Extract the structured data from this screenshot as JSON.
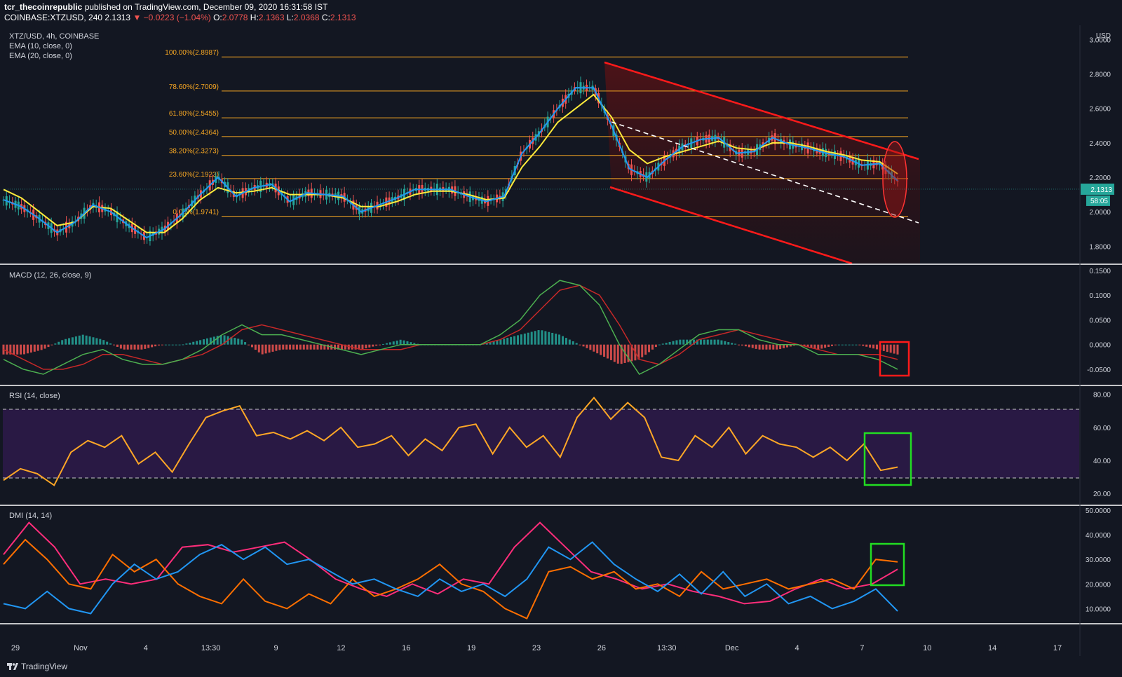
{
  "header": {
    "author": "tcr_thecoinrepublic",
    "published": " published on TradingView.com, December 09, 2020 16:31:58 IST",
    "symbol": "COINBASE:XTZUSD, 240",
    "last": "2.1313",
    "change": "−0.0223 (−1.04%)",
    "o": "2.0778",
    "h": "2.1363",
    "l": "2.0368",
    "c": "2.1313"
  },
  "legend": {
    "pair": "XTZ/USD, 4h, COINBASE",
    "ema10": "EMA (10, close, 0)",
    "ema20": "EMA (20, close, 0)",
    "macd": "MACD (12, 26, close, 9)",
    "rsi": "RSI (14, close)",
    "dmi": "DMI (14, 14)"
  },
  "price_axis": {
    "unit": "USD",
    "ticks": [
      "3.0000",
      "2.8000",
      "2.6000",
      "2.4000",
      "2.2000",
      "2.0000",
      "1.8000"
    ],
    "current_label": "2.1313",
    "countdown": "58:05"
  },
  "fib_levels": [
    {
      "label": "100.00%(2.8987)",
      "value": 2.8987
    },
    {
      "label": "78.60%(2.7009)",
      "value": 2.7009
    },
    {
      "label": "61.80%(2.5455)",
      "value": 2.5455
    },
    {
      "label": "50.00%(2.4364)",
      "value": 2.4364
    },
    {
      "label": "38.20%(2.3273)",
      "value": 2.3273
    },
    {
      "label": "23.60%(2.1923)",
      "value": 2.1923
    },
    {
      "label": "0.00%(1.9741)",
      "value": 1.9741
    }
  ],
  "macd_axis": [
    "0.1500",
    "0.1000",
    "0.0500",
    "0.0000",
    "-0.0500"
  ],
  "rsi_axis": [
    "80.00",
    "60.00",
    "40.00",
    "20.00"
  ],
  "dmi_axis": [
    "50.0000",
    "40.0000",
    "30.0000",
    "20.0000",
    "10.0000"
  ],
  "time_axis": [
    "29",
    "Nov",
    "4",
    "13:30",
    "9",
    "12",
    "16",
    "19",
    "23",
    "26",
    "13:30",
    "Dec",
    "4",
    "7",
    "10",
    "14",
    "17"
  ],
  "footer": {
    "brand": "TradingView"
  },
  "colors": {
    "up": "#26a69a",
    "down": "#ef5350",
    "ema10": "#2196f3",
    "ema20": "#ffeb3b",
    "fib": "#f5a623",
    "channel": "#ff1a1a",
    "rsi": "#ffa726",
    "macd": "#4caf50",
    "signal": "#c62828",
    "dmi_plus": "#2196f3",
    "dmi_minus": "#ff6f00",
    "adx": "#ff2d7a"
  },
  "chart_data": [
    {
      "type": "candlestick",
      "title": "XTZ/USD, 4h, COINBASE",
      "ylim": [
        1.7,
        3.05
      ],
      "series": [
        {
          "name": "EMA (10, close, 0)",
          "values": [
            2.07,
            2.03,
            1.96,
            1.88,
            1.94,
            2.04,
            2.0,
            1.92,
            1.85,
            1.9,
            1.99,
            2.1,
            2.2,
            2.09,
            2.14,
            2.16,
            2.06,
            2.11,
            2.1,
            2.09,
            2.0,
            2.04,
            2.08,
            2.13,
            2.13,
            2.13,
            2.09,
            2.06,
            2.09,
            2.34,
            2.46,
            2.6,
            2.72,
            2.72,
            2.5,
            2.25,
            2.2,
            2.3,
            2.38,
            2.42,
            2.43,
            2.34,
            2.35,
            2.43,
            2.39,
            2.37,
            2.34,
            2.32,
            2.27,
            2.28,
            2.18
          ]
        },
        {
          "name": "EMA (20, close, 0)",
          "values": [
            2.13,
            2.08,
            2.0,
            1.92,
            1.94,
            2.03,
            2.02,
            1.95,
            1.88,
            1.88,
            1.96,
            2.07,
            2.14,
            2.11,
            2.12,
            2.14,
            2.1,
            2.1,
            2.1,
            2.08,
            2.03,
            2.03,
            2.06,
            2.1,
            2.12,
            2.12,
            2.1,
            2.07,
            2.08,
            2.26,
            2.38,
            2.52,
            2.6,
            2.68,
            2.55,
            2.36,
            2.28,
            2.32,
            2.35,
            2.38,
            2.41,
            2.37,
            2.36,
            2.4,
            2.4,
            2.38,
            2.35,
            2.33,
            2.3,
            2.29,
            2.22
          ]
        }
      ]
    },
    {
      "type": "line",
      "title": "MACD (12, 26, close, 9)",
      "ylim": [
        -0.07,
        0.15
      ],
      "series": [
        {
          "name": "MACD",
          "values": [
            -0.03,
            -0.05,
            -0.06,
            -0.04,
            -0.02,
            -0.01,
            -0.03,
            -0.04,
            -0.04,
            -0.03,
            -0.01,
            0.02,
            0.04,
            0.02,
            0.02,
            0.01,
            0.0,
            -0.01,
            -0.02,
            -0.01,
            0.0,
            0.0,
            0.0,
            0.0,
            0.0,
            0.02,
            0.05,
            0.1,
            0.13,
            0.12,
            0.08,
            0.0,
            -0.06,
            -0.04,
            -0.01,
            0.02,
            0.03,
            0.03,
            0.01,
            0.0,
            0.0,
            -0.02,
            -0.02,
            -0.02,
            -0.03,
            -0.05
          ]
        },
        {
          "name": "Signal",
          "values": [
            -0.01,
            -0.03,
            -0.05,
            -0.05,
            -0.04,
            -0.02,
            -0.02,
            -0.03,
            -0.04,
            -0.03,
            -0.02,
            0.0,
            0.03,
            0.04,
            0.03,
            0.02,
            0.01,
            0.0,
            -0.01,
            -0.01,
            -0.01,
            0.0,
            0.0,
            0.0,
            0.0,
            0.01,
            0.03,
            0.07,
            0.11,
            0.12,
            0.1,
            0.04,
            -0.03,
            -0.04,
            -0.02,
            0.01,
            0.02,
            0.03,
            0.02,
            0.01,
            0.0,
            -0.01,
            -0.02,
            -0.02,
            -0.02,
            -0.03
          ]
        }
      ]
    },
    {
      "type": "line",
      "title": "RSI (14, close)",
      "ylim": [
        15,
        82
      ],
      "series": [
        {
          "name": "RSI",
          "values": [
            28,
            35,
            32,
            25,
            45,
            52,
            48,
            55,
            38,
            45,
            33,
            50,
            66,
            70,
            73,
            55,
            57,
            53,
            58,
            52,
            60,
            48,
            50,
            55,
            43,
            53,
            46,
            60,
            62,
            44,
            60,
            48,
            55,
            42,
            66,
            78,
            65,
            75,
            66,
            42,
            40,
            55,
            48,
            60,
            44,
            55,
            50,
            48,
            42,
            48,
            40,
            50,
            34,
            36
          ]
        }
      ]
    },
    {
      "type": "line",
      "title": "DMI (14, 14)",
      "ylim": [
        5,
        50
      ],
      "series": [
        {
          "name": "DMI+",
          "values": [
            12,
            10,
            17,
            10,
            8,
            20,
            28,
            22,
            25,
            32,
            36,
            30,
            35,
            28,
            30,
            25,
            20,
            22,
            18,
            15,
            22,
            17,
            20,
            15,
            22,
            35,
            30,
            37,
            28,
            22,
            17,
            24,
            16,
            25,
            15,
            20,
            12,
            15,
            10,
            13,
            18,
            9
          ]
        },
        {
          "name": "DMI−",
          "values": [
            28,
            38,
            30,
            20,
            18,
            32,
            25,
            30,
            20,
            15,
            12,
            22,
            13,
            10,
            16,
            12,
            22,
            15,
            18,
            22,
            28,
            20,
            17,
            10,
            6,
            25,
            27,
            22,
            25,
            18,
            20,
            15,
            25,
            18,
            20,
            22,
            18,
            20,
            22,
            18,
            30,
            29
          ]
        },
        {
          "name": "ADX",
          "values": [
            32,
            45,
            35,
            20,
            22,
            20,
            22,
            35,
            36,
            33,
            35,
            37,
            30,
            22,
            18,
            15,
            20,
            16,
            22,
            20,
            35,
            45,
            35,
            25,
            22,
            18,
            20,
            17,
            15,
            12,
            13,
            18,
            22,
            18,
            20,
            26
          ]
        }
      ]
    }
  ]
}
